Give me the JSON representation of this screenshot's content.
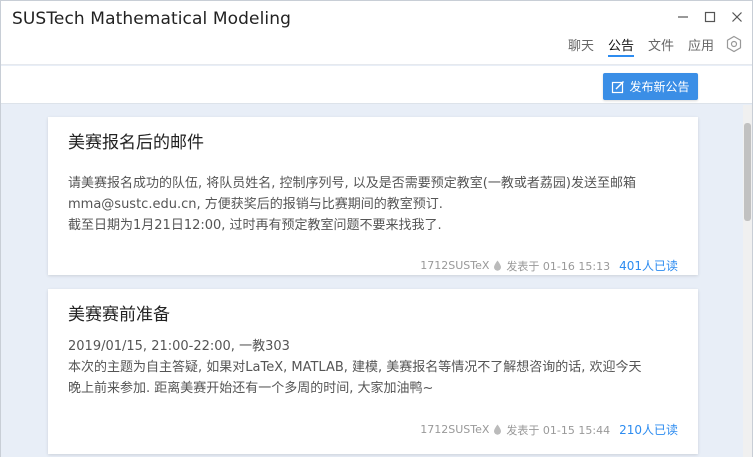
{
  "window": {
    "title": "SUSTech Mathematical Modeling"
  },
  "nav": {
    "tabs": [
      {
        "label": "聊天"
      },
      {
        "label": "公告"
      },
      {
        "label": "文件"
      },
      {
        "label": "应用"
      }
    ],
    "active_tab": "公告"
  },
  "toolbar": {
    "publish_label": "发布新公告"
  },
  "announcements": [
    {
      "title": "美赛报名后的邮件",
      "lines": [
        "请美赛报名成功的队伍, 将队员姓名, 控制序列号, 以及是否需要预定教室(一教或者荔园)发送至邮箱",
        "mma@sustc.edu.cn, 方便获奖后的报销与比赛期间的教室预订.",
        "截至日期为1月21日12:00, 过时再有预定教室问题不要来找我了."
      ],
      "author": "1712SUSTeX",
      "posted": "发表于 01-16 15:13",
      "reads": "401人已读"
    },
    {
      "title": "美赛赛前准备",
      "lines": [
        "2019/01/15, 21:00-22:00, 一教303",
        "本次的主题为自主答疑, 如果对LaTeX, MATLAB, 建模, 美赛报名等情况不了解想咨询的话, 欢迎今天",
        "晚上前来参加. 距离美赛开始还有一个多周的时间, 大家加油鸭~"
      ],
      "author": "1712SUSTeX",
      "posted": "发表于 01-15 15:44",
      "reads": "210人已读"
    }
  ],
  "colors": {
    "accent": "#3a8ee6",
    "link": "#2d8cf0",
    "background": "#e8eef7"
  }
}
